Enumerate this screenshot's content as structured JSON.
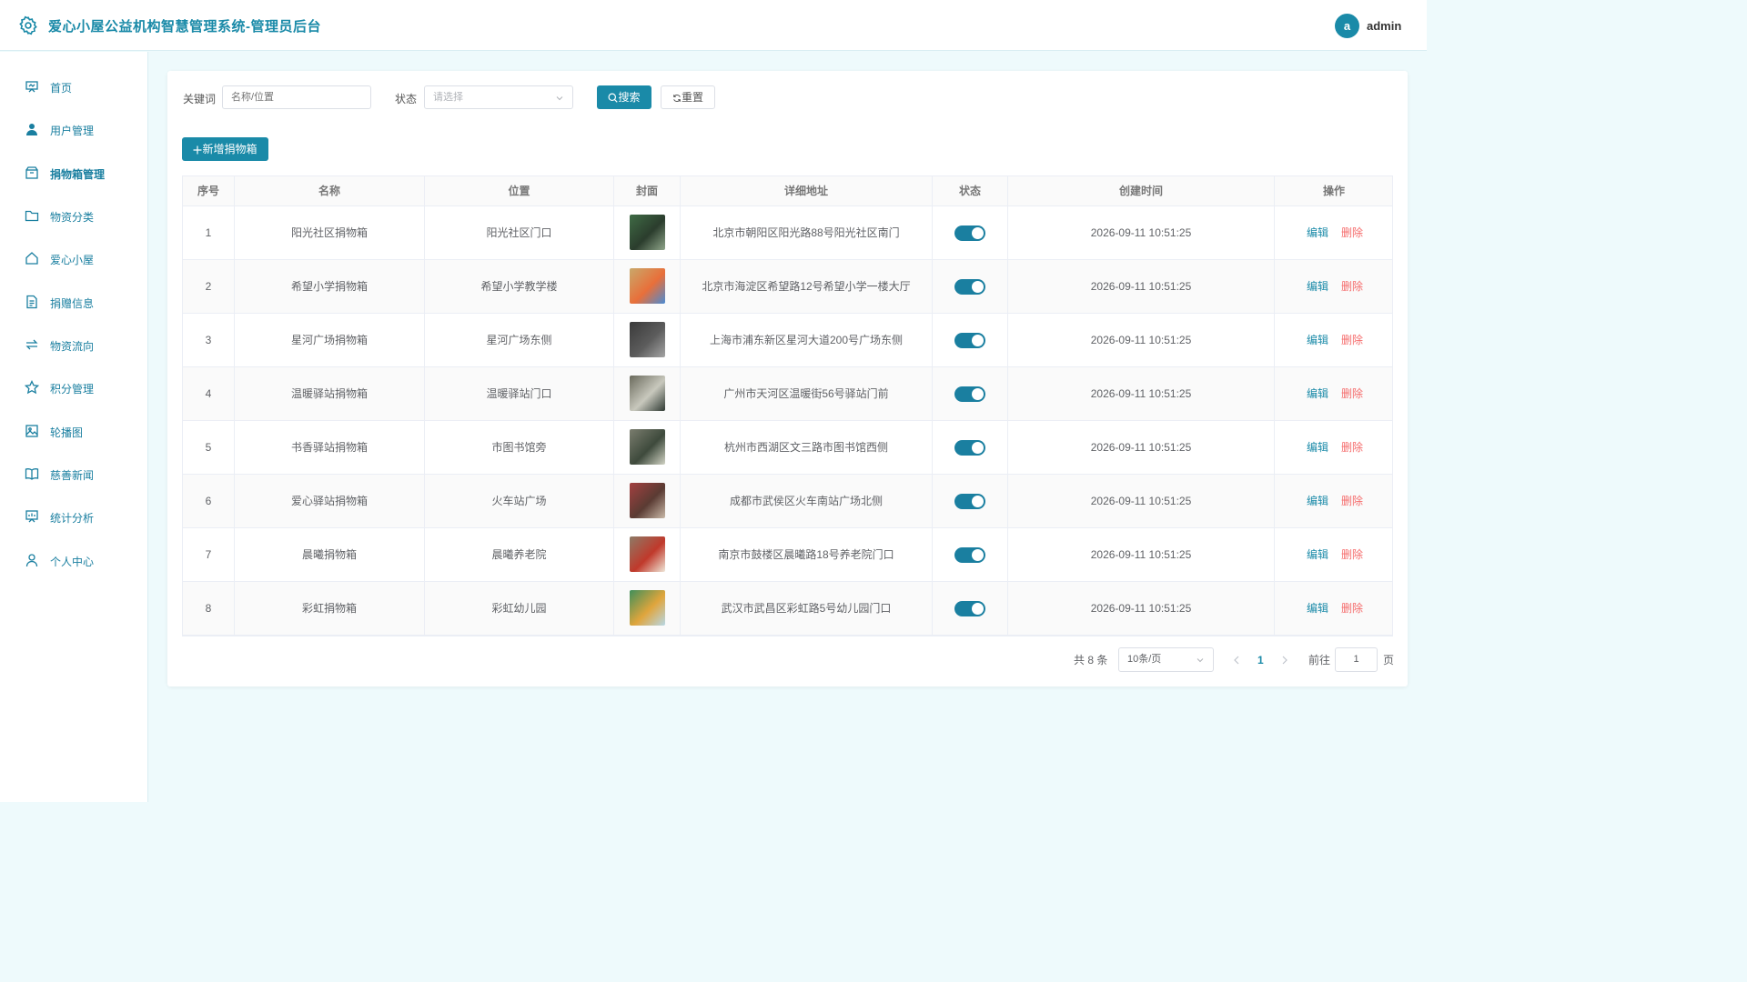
{
  "header": {
    "title": "爱心小屋公益机构智慧管理系统-管理员后台",
    "avatar_letter": "a",
    "username": "admin"
  },
  "sidebar": {
    "items": [
      {
        "label": "首页",
        "icon": "dashboard-icon"
      },
      {
        "label": "用户管理",
        "icon": "user-icon"
      },
      {
        "label": "捐物箱管理",
        "icon": "box-icon",
        "active": true
      },
      {
        "label": "物资分类",
        "icon": "folder-icon"
      },
      {
        "label": "爱心小屋",
        "icon": "home-icon"
      },
      {
        "label": "捐赠信息",
        "icon": "document-icon"
      },
      {
        "label": "物资流向",
        "icon": "flow-icon"
      },
      {
        "label": "积分管理",
        "icon": "star-icon"
      },
      {
        "label": "轮播图",
        "icon": "image-icon"
      },
      {
        "label": "慈善新闻",
        "icon": "book-icon"
      },
      {
        "label": "统计分析",
        "icon": "chart-icon"
      },
      {
        "label": "个人中心",
        "icon": "person-icon"
      }
    ]
  },
  "filter": {
    "keyword_label": "关键词",
    "keyword_placeholder": "名称/位置",
    "status_label": "状态",
    "status_placeholder": "请选择",
    "search_label": "搜索",
    "reset_label": "重置"
  },
  "add_button_label": "新增捐物箱",
  "table": {
    "columns": [
      "序号",
      "名称",
      "位置",
      "封面",
      "详细地址",
      "状态",
      "创建时间",
      "操作"
    ],
    "rows": [
      {
        "no": "1",
        "name": "阳光社区捐物箱",
        "location": "阳光社区门口",
        "address": "北京市朝阳区阳光路88号阳光社区南门",
        "enabled": true,
        "created": "2026-09-11 10:51:25"
      },
      {
        "no": "2",
        "name": "希望小学捐物箱",
        "location": "希望小学教学楼",
        "address": "北京市海淀区希望路12号希望小学一楼大厅",
        "enabled": true,
        "created": "2026-09-11 10:51:25"
      },
      {
        "no": "3",
        "name": "星河广场捐物箱",
        "location": "星河广场东侧",
        "address": "上海市浦东新区星河大道200号广场东侧",
        "enabled": true,
        "created": "2026-09-11 10:51:25"
      },
      {
        "no": "4",
        "name": "温暖驿站捐物箱",
        "location": "温暖驿站门口",
        "address": "广州市天河区温暖街56号驿站门前",
        "enabled": true,
        "created": "2026-09-11 10:51:25"
      },
      {
        "no": "5",
        "name": "书香驿站捐物箱",
        "location": "市图书馆旁",
        "address": "杭州市西湖区文三路市图书馆西侧",
        "enabled": true,
        "created": "2026-09-11 10:51:25"
      },
      {
        "no": "6",
        "name": "爱心驿站捐物箱",
        "location": "火车站广场",
        "address": "成都市武侯区火车南站广场北侧",
        "enabled": true,
        "created": "2026-09-11 10:51:25"
      },
      {
        "no": "7",
        "name": "晨曦捐物箱",
        "location": "晨曦养老院",
        "address": "南京市鼓楼区晨曦路18号养老院门口",
        "enabled": true,
        "created": "2026-09-11 10:51:25"
      },
      {
        "no": "8",
        "name": "彩虹捐物箱",
        "location": "彩虹幼儿园",
        "address": "武汉市武昌区彩虹路5号幼儿园门口",
        "enabled": true,
        "created": "2026-09-11 10:51:25"
      }
    ],
    "edit_label": "编辑",
    "delete_label": "删除"
  },
  "pagination": {
    "total": "共 8 条",
    "page_size": "10条/页",
    "current_page": "1",
    "goto_label": "前往",
    "goto_value": "1",
    "page_suffix": "页"
  },
  "colors": {
    "brand": "#1a8aa8",
    "danger": "#f56c6c",
    "background": "#eefafc"
  }
}
